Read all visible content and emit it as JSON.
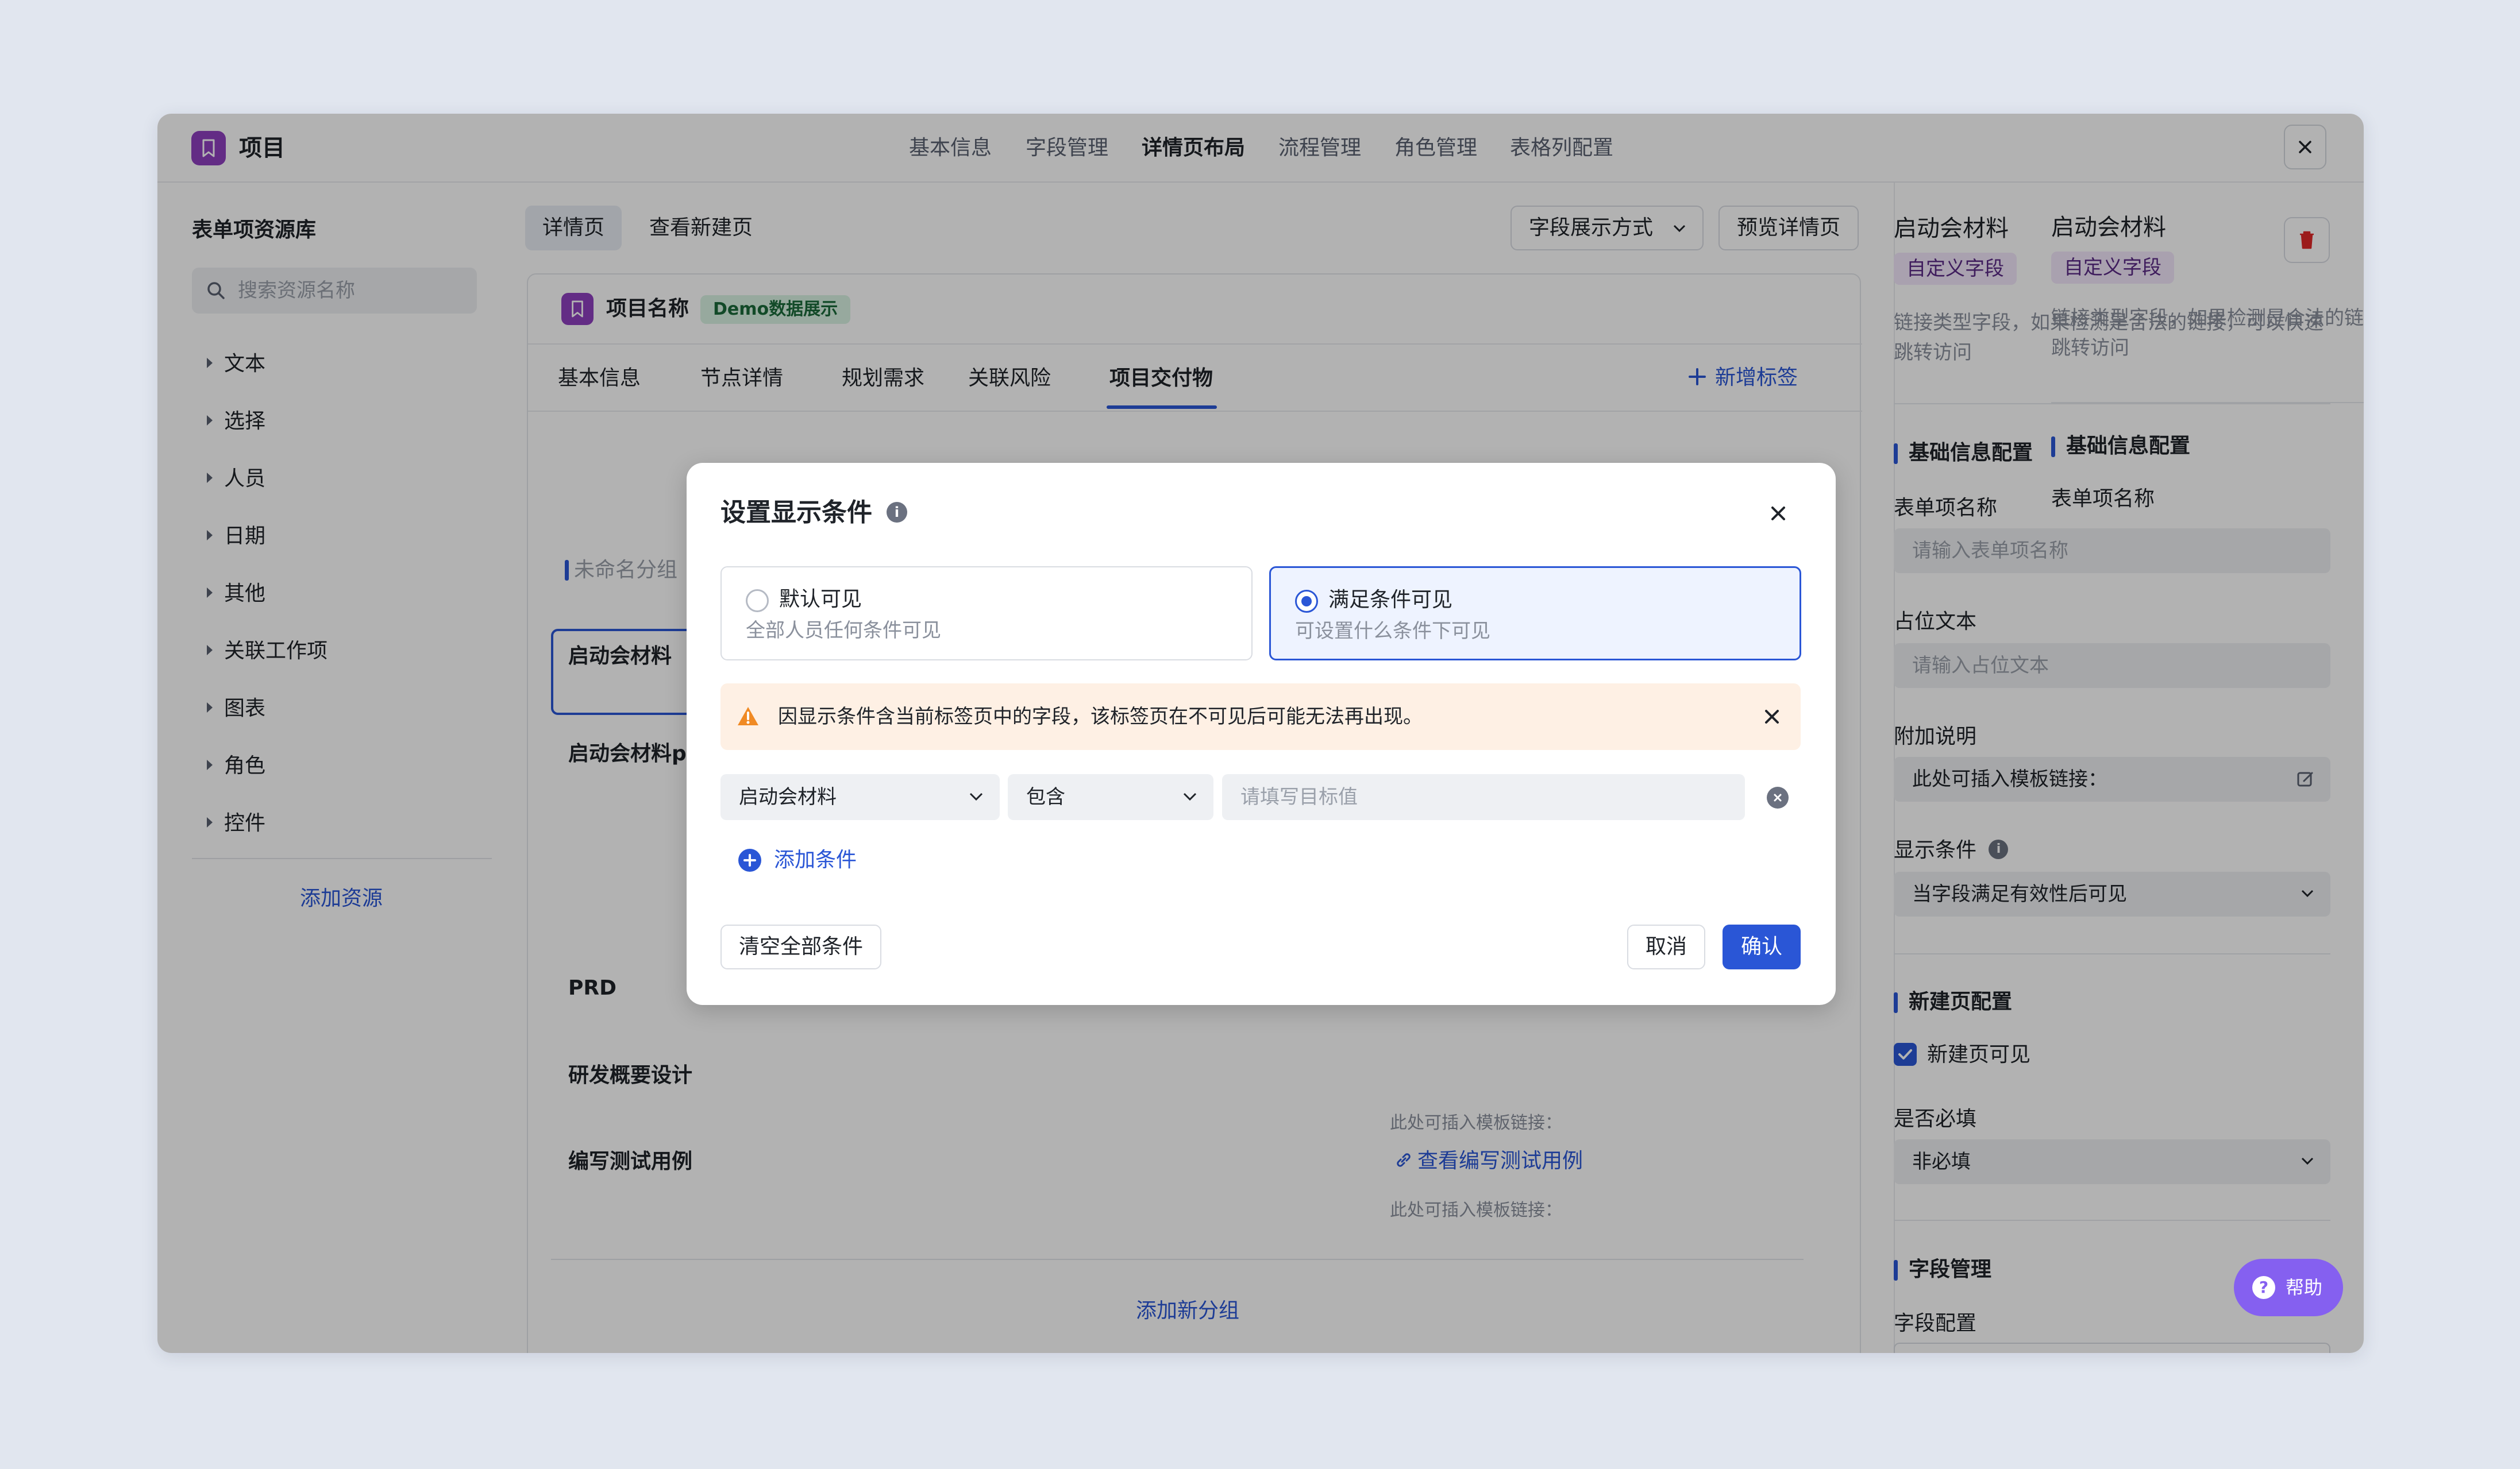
{
  "window": {
    "app_title": "项目",
    "nav": [
      "基本信息",
      "字段管理",
      "详情页布局",
      "流程管理",
      "角色管理",
      "表格列配置"
    ],
    "active_nav_index": 2
  },
  "left_panel": {
    "title": "表单项资源库",
    "search_placeholder": "搜索资源名称",
    "items": [
      "文本",
      "选择",
      "人员",
      "日期",
      "其他",
      "关联工作项",
      "图表",
      "角色",
      "控件"
    ],
    "add_resource": "添加资源"
  },
  "center": {
    "tabs": [
      "详情页",
      "查看新建页"
    ],
    "field_display_mode": "字段展示方式",
    "preview_button": "预览详情页",
    "project_name": "项目名称",
    "demo_badge": "Demo数据展示",
    "card_tabs": [
      "基本信息",
      "节点详情",
      "规划需求",
      "关联风险",
      "项目交付物"
    ],
    "active_card_tab": 4,
    "add_tag": "新增标签",
    "group_name": "未命名分组",
    "fields": [
      "启动会材料",
      "启动会材料pp",
      "PRD",
      "研发概要设计",
      "编写测试用例"
    ],
    "template_hint": "此处可插入模板链接：",
    "test_case_link": "查看编写测试用例",
    "add_group": "添加新分组"
  },
  "right_panel": {
    "title": "启动会材料",
    "badge": "自定义字段",
    "description": "链接类型字段，如果检测是合法的链接，可以快速跳转访问",
    "section_basic": "基础信息配置",
    "label_name": "表单项名称",
    "name_placeholder": "请输入表单项名称",
    "label_placeholder": "占位文本",
    "placeholder_placeholder": "请输入占位文本",
    "label_extra": "附加说明",
    "extra_value": "此处可插入模板链接：",
    "label_condition": "显示条件",
    "condition_value": "当字段满足有效性后可见",
    "section_new": "新建页配置",
    "new_visible": "新建页可见",
    "new_visible_checked": true,
    "label_required": "是否必填",
    "required_value": "非必填",
    "section_field": "字段管理",
    "label_field_config": "字段配置",
    "help": "帮助"
  },
  "modal": {
    "title": "设置显示条件",
    "option_default": {
      "title": "默认可见",
      "desc": "全部人员任何条件可见",
      "selected": false
    },
    "option_condition": {
      "title": "满足条件可见",
      "desc": "可设置什么条件下可见",
      "selected": true
    },
    "warning": "因显示条件含当前标签页中的字段，该标签页在不可见后可能无法再出现。",
    "condition_field": "启动会材料",
    "condition_operator": "包含",
    "condition_value_placeholder": "请填写目标值",
    "add_condition": "添加条件",
    "clear_all": "清空全部条件",
    "cancel": "取消",
    "confirm": "确认"
  },
  "colors": {
    "accent": "#2a56d6",
    "brand_purple": "#8f3fbf",
    "help_purple": "#8560f0",
    "warning_bg": "#fef0e4",
    "warning_icon": "#f08a24"
  }
}
